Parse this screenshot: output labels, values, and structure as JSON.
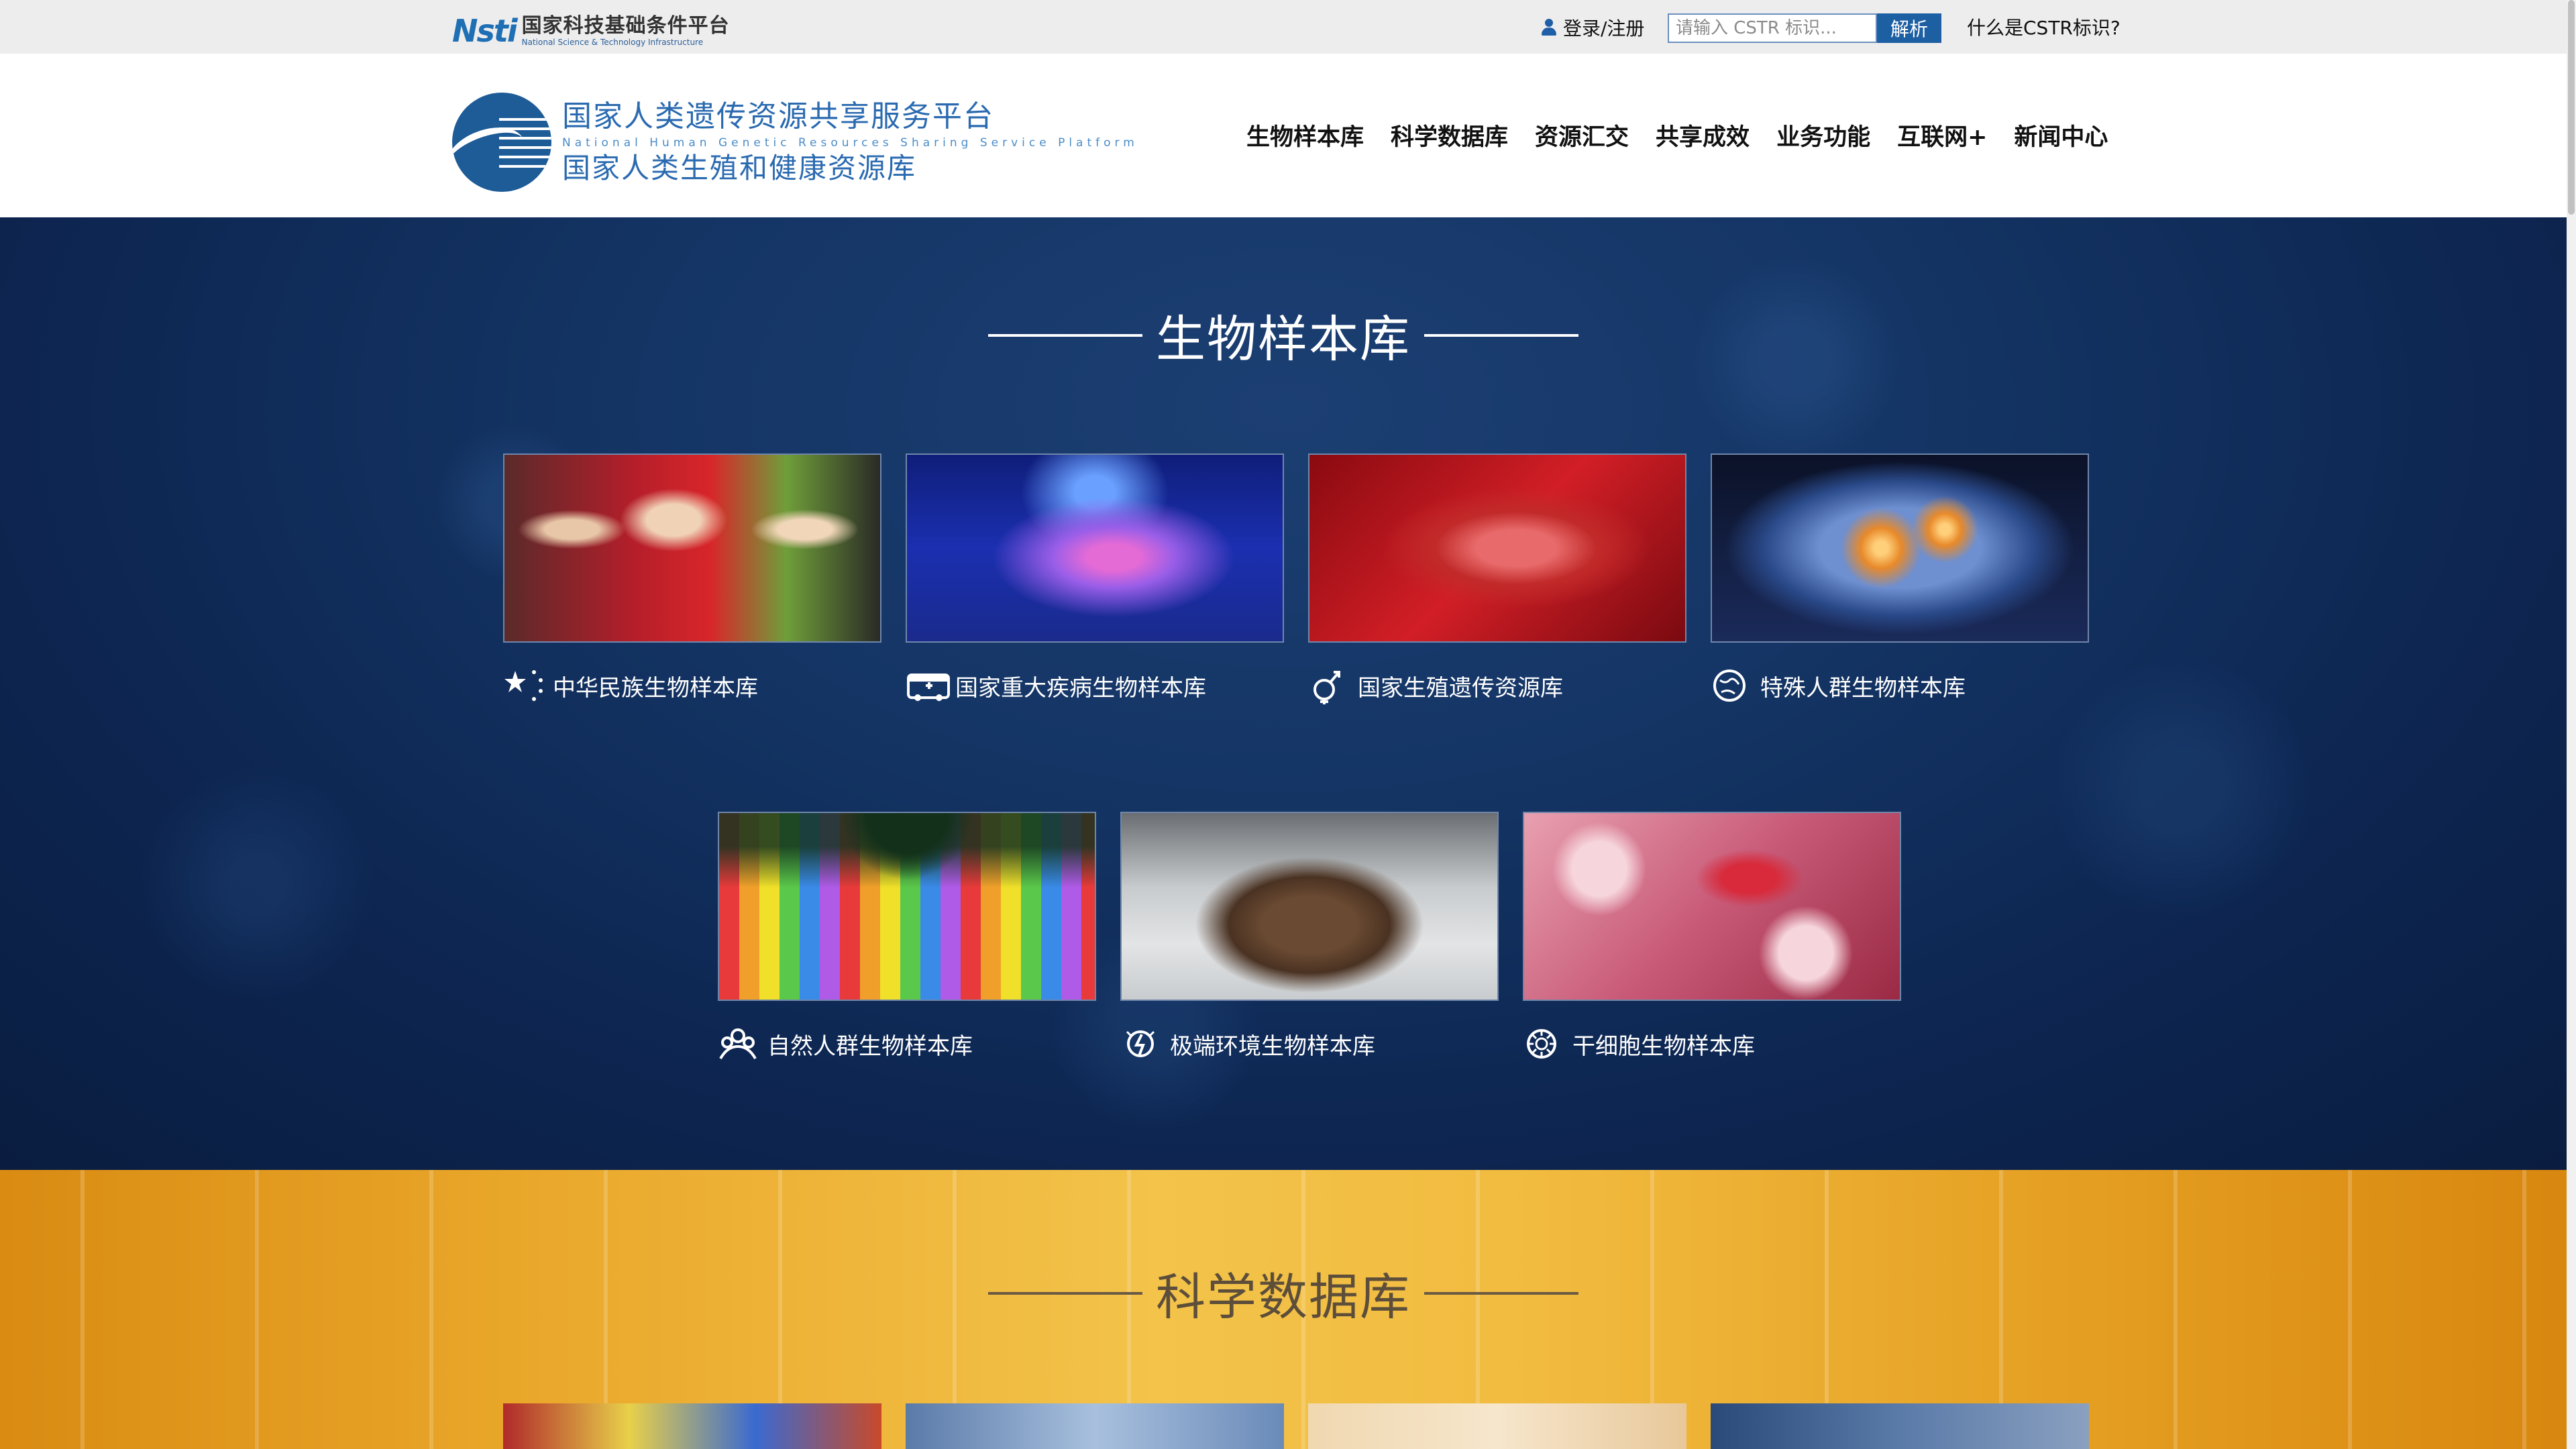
{
  "topbar": {
    "nsti_mark": "Nsti",
    "nsti_name": "国家科技基础条件平台",
    "nsti_en": "National Science & Technology Infrastructure",
    "login_label": "登录/注册",
    "cstr_placeholder": "请输入 CSTR 标识...",
    "parse_button": "解析",
    "what_is_cstr": "什么是CSTR标识?"
  },
  "header": {
    "logo_cn_line1": "国家人类遗传资源共享服务平台",
    "logo_en": "National Human Genetic Resources Sharing Service Platform",
    "logo_cn_line2": "国家人类生殖和健康资源库",
    "nav": [
      "生物样本库",
      "科学数据库",
      "资源汇交",
      "共享成效",
      "业务功能",
      "互联网+",
      "新闻中心"
    ]
  },
  "biobank": {
    "title": "生物样本库",
    "cards": [
      {
        "label": "中华民族生物样本库",
        "icon": "stars-icon"
      },
      {
        "label": "国家重大疾病生物样本库",
        "icon": "ambulance-icon"
      },
      {
        "label": "国家生殖遗传资源库",
        "icon": "gender-icon"
      },
      {
        "label": "特殊人群生物样本库",
        "icon": "globe-icon"
      },
      {
        "label": "自然人群生物样本库",
        "icon": "people-icon"
      },
      {
        "label": "极端环境生物样本库",
        "icon": "storm-icon"
      },
      {
        "label": "干细胞生物样本库",
        "icon": "cell-icon"
      }
    ]
  },
  "science": {
    "title": "科学数据库"
  },
  "colors": {
    "brand_blue": "#1d5fa3",
    "biobank_bg": "#143565",
    "science_bg": "#f1bb3f"
  }
}
